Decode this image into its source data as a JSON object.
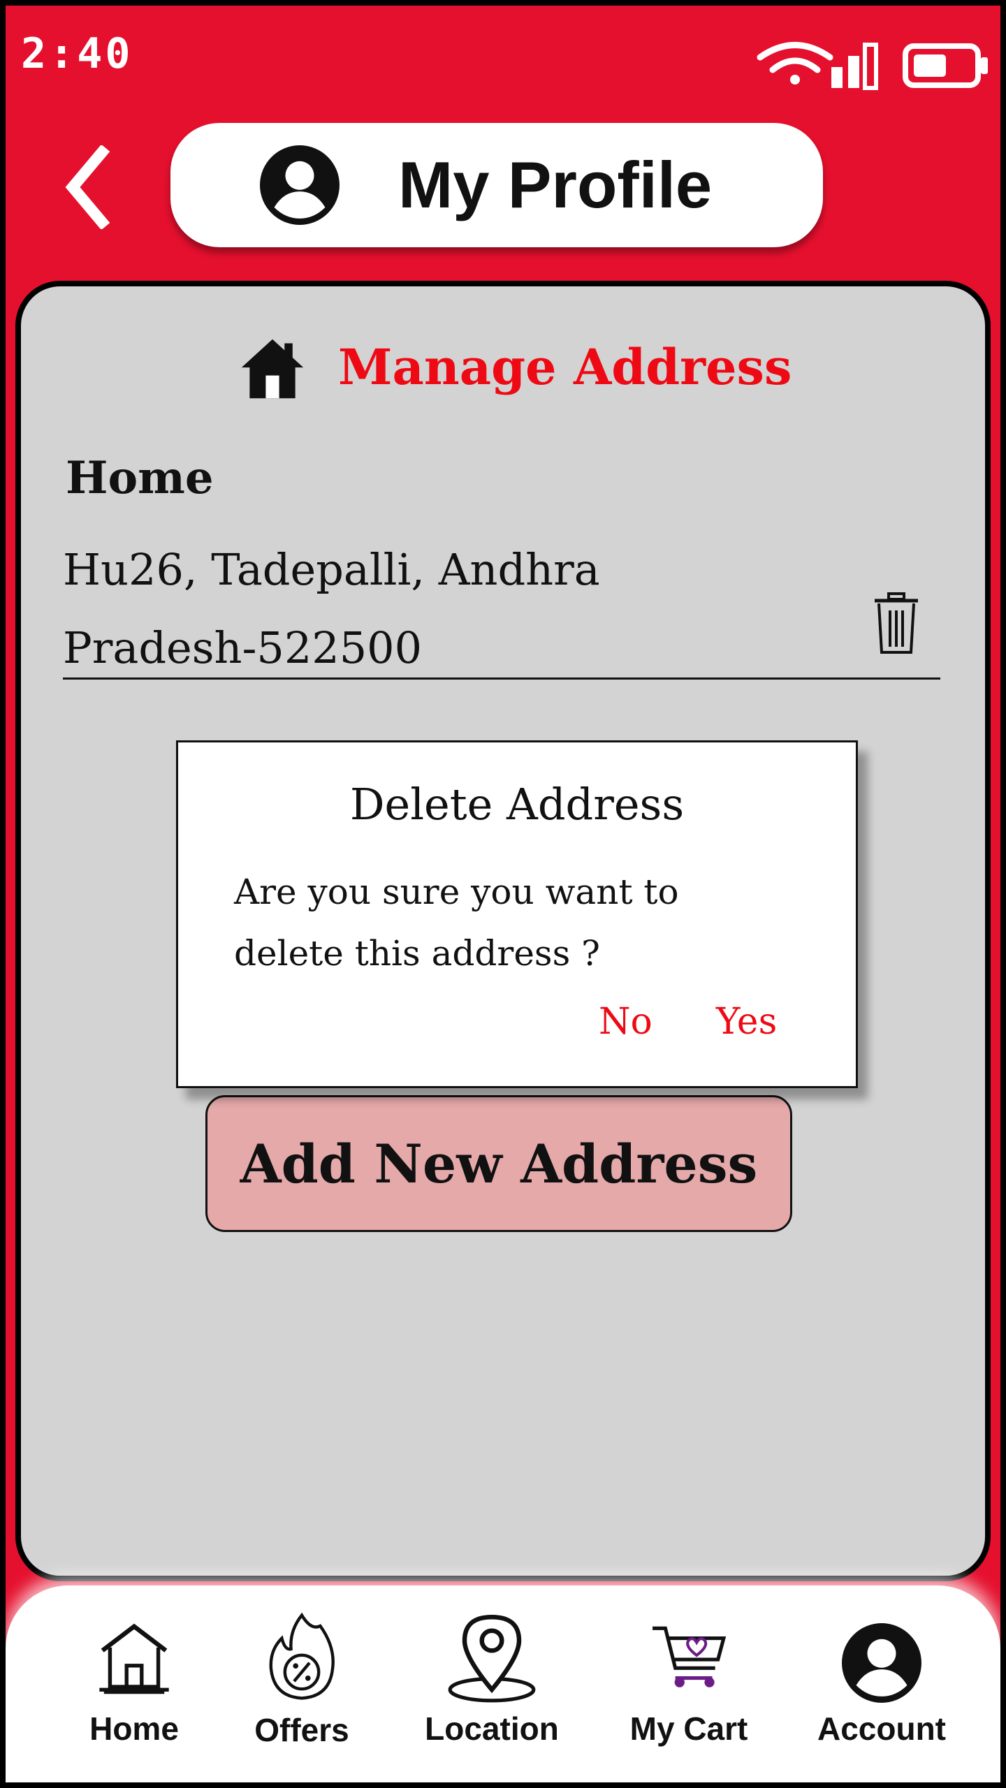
{
  "status_bar": {
    "time": "2:40"
  },
  "header": {
    "title": "My Profile"
  },
  "manage_address": {
    "title": "Manage Address",
    "address": {
      "label": "Home",
      "line1": "Hu26, Tadepalli, Andhra",
      "line2": "Pradesh-522500"
    },
    "add_button_label": "Add New Address"
  },
  "dialog": {
    "title": "Delete Address",
    "message_line1": "Are you sure you want to",
    "message_line2": "delete this address ?",
    "no_label": "No",
    "yes_label": "Yes"
  },
  "bottom_nav": {
    "items": [
      {
        "label": "Home",
        "icon": "house-icon"
      },
      {
        "label": "Offers",
        "icon": "offer-badge-icon"
      },
      {
        "label": "Location",
        "icon": "location-pin-icon"
      },
      {
        "label": "My Cart",
        "icon": "cart-icon"
      },
      {
        "label": "Account",
        "icon": "account-icon"
      }
    ]
  },
  "colors": {
    "brand_red": "#E5102E",
    "accent_red": "#EE0A14",
    "card_gray": "#D3D3D3",
    "button_pink": "#E5A9AA"
  }
}
